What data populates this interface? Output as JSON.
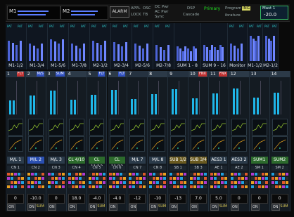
{
  "topbar": {
    "meter1_label": "M1",
    "meter2_label": "M2",
    "alarm": "ALARM",
    "appl": "APPL",
    "osc": "OSC",
    "lock": "LOCK",
    "tb": "TB",
    "dc_pwr": "DC Pwr",
    "ac_pwr": "AC Pwr",
    "sync": "Sync",
    "dsp": "DSP",
    "cascade": "Cascade",
    "primary": "Primary",
    "program": "Program",
    "ing": "ING",
    "ibrature": "ibrature",
    "meter_hdr": "Mast 1",
    "readout": "-20.0"
  },
  "mix_labels": [
    "M1-1/2",
    "M1-3/4",
    "M1-5/6",
    "M1-7/8",
    "M2-1/2",
    "M2-3/4",
    "M2-5/6",
    "M2-7/8",
    "SUM 1 - 8",
    "SUM 9 - 16",
    "Monitor",
    "M1-1/2",
    "M2-1/2"
  ],
  "patch_label": "PAT",
  "channels": [
    {
      "num": "1",
      "tag": "FLT",
      "name": "M/L 1",
      "input": "CN 1",
      "gain": "0",
      "tagcolor": "#c03030",
      "namecolor": "#2b3b4a"
    },
    {
      "num": "2",
      "tag": "M/S",
      "name": "M/L 2",
      "input": "CN 2",
      "gain": "-10.0",
      "tagcolor": "#3050c0",
      "namecolor": "#2a4fb0"
    },
    {
      "num": "3",
      "tag": "SUM",
      "name": "M/L 3",
      "input": "CN 3",
      "gain": "0",
      "tagcolor": "#3050c0",
      "namecolor": "#2b3b4a"
    },
    {
      "num": "4",
      "tag": "",
      "name": "CL 4/10",
      "input": "CN 4",
      "gain": "18.0",
      "tagcolor": "#000",
      "namecolor": "#2c6a2c"
    },
    {
      "num": "5",
      "tag": "FLT",
      "name": "CL 11/12",
      "input": "CN 5",
      "gain": "-4.0",
      "tagcolor": "#3050c0",
      "namecolor": "#2c6a2c"
    },
    {
      "num": "6",
      "tag": "FLT",
      "name": "CL 11/12",
      "input": "CN 6",
      "gain": "-4.0",
      "tagcolor": "#3050c0",
      "namecolor": "#2c6a2c"
    },
    {
      "num": "7",
      "tag": "",
      "name": "M/L 7",
      "input": "CN 7",
      "gain": "-12",
      "tagcolor": "#000",
      "namecolor": "#2b3b4a"
    },
    {
      "num": "8",
      "tag": "",
      "name": "M/L 8",
      "input": "CN 8",
      "gain": "-10",
      "tagcolor": "#000",
      "namecolor": "#2b3b4a"
    },
    {
      "num": "9",
      "tag": "",
      "name": "SUB 1/2",
      "input": "SB 1",
      "gain": "-13",
      "tagcolor": "#000",
      "namecolor": "#6a5a20"
    },
    {
      "num": "10",
      "tag": "FNX",
      "name": "SUB 3/4",
      "input": "SB 3",
      "gain": "7.0",
      "tagcolor": "#c03030",
      "namecolor": "#6a5a20"
    },
    {
      "num": "11",
      "tag": "FNX",
      "name": "AES3 1",
      "input": "AE 1",
      "gain": "5.0",
      "tagcolor": "#c03030",
      "namecolor": "#2b3b4a"
    },
    {
      "num": "12",
      "tag": "",
      "name": "AES3 2",
      "input": "AE 2",
      "gain": "0",
      "tagcolor": "#000",
      "namecolor": "#2b3b4a"
    },
    {
      "num": "13",
      "tag": "",
      "name": "SUM1",
      "input": "SM 1",
      "gain": "0",
      "tagcolor": "#000",
      "namecolor": "#2c6a2c"
    },
    {
      "num": "14",
      "tag": "",
      "name": "SUM2",
      "input": "SM 2",
      "gain": "0",
      "tagcolor": "#000",
      "namecolor": "#2c6a2c"
    }
  ],
  "on_label": "ON",
  "sum_label": "SUM"
}
